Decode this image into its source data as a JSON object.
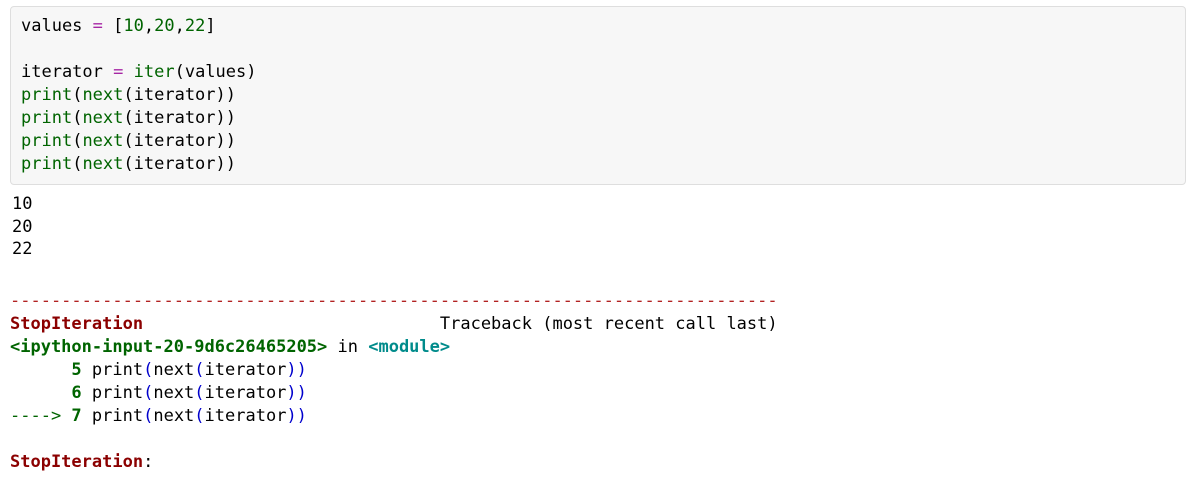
{
  "code": {
    "line1_a": "values ",
    "line1_eq": "=",
    "line1_b": " ",
    "line1_br_open": "[",
    "line1_n1": "10",
    "line1_c1": ",",
    "line1_n2": "20",
    "line1_c2": ",",
    "line1_n3": "22",
    "line1_br_close": "]",
    "line3_a": "iterator ",
    "line3_eq": "=",
    "line3_b": " ",
    "line3_iter": "iter",
    "line3_p1": "(",
    "line3_arg": "values",
    "line3_p2": ")",
    "pl": {
      "print": "print",
      "p1": "(",
      "next": "next",
      "p2": "(",
      "arg": "iterator",
      "p3": ")",
      "p4": ")"
    }
  },
  "output": {
    "line1": "10",
    "line2": "20",
    "line3": "22"
  },
  "traceback": {
    "separator": "---------------------------------------------------------------------------",
    "err_name": "StopIteration",
    "header_spacing": "                             ",
    "header_rest": "Traceback (most recent call last)",
    "src_ref": "<ipython-input-20-9d6c26465205>",
    "in_word": " in ",
    "module": "<module>",
    "l5_num": "      5",
    "l5_sp": " print",
    "l5_p1": "(",
    "l5_next": "next",
    "l5_p2": "(",
    "l5_arg": "iterator",
    "l5_p3": "))",
    "l6_num": "      6",
    "l6_sp": " print",
    "l6_p1": "(",
    "l6_next": "next",
    "l6_p2": "(",
    "l6_arg": "iterator",
    "l6_p3": "))",
    "arrow": "----> ",
    "l7_num": "7",
    "l7_sp": " print",
    "l7_p1": "(",
    "l7_next": "next",
    "l7_p2": "(",
    "l7_arg": "iterator",
    "l7_p3": "))",
    "final_err": "StopIteration",
    "final_colon": ": "
  }
}
